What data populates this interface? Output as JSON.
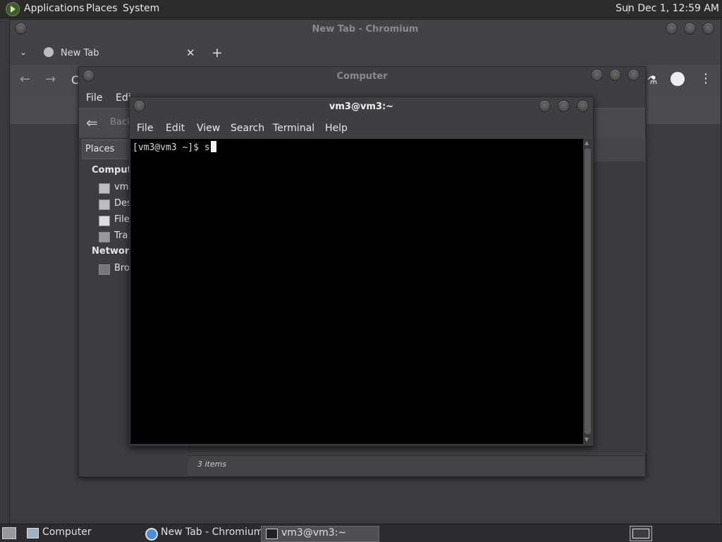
{
  "top_panel": {
    "menus": [
      "Applications",
      "Places",
      "System"
    ],
    "clock": "Sun Dec  1, 12:59 AM"
  },
  "chromium": {
    "title": "New Tab - Chromium",
    "tab_label": "New Tab",
    "address_partial": "C"
  },
  "nautilus": {
    "title": "Computer",
    "menu_partial": [
      "File",
      "Edi"
    ],
    "back_label": "Back",
    "places_label": "Places",
    "sidebar": {
      "computer_header": "Compute",
      "computer_items": [
        "vm3",
        "Des",
        "File",
        "Tra"
      ],
      "network_header": "Network",
      "network_items": [
        "Bro"
      ]
    },
    "status": "3 items"
  },
  "terminal": {
    "title": "vm3@vm3:~",
    "menus": [
      "File",
      "Edit",
      "View",
      "Search",
      "Terminal",
      "Help"
    ],
    "prompt": "[vm3@vm3 ~]$ s"
  },
  "taskbar": {
    "tasks": [
      "Computer",
      "New Tab - Chromium",
      "vm3@vm3:~"
    ]
  }
}
